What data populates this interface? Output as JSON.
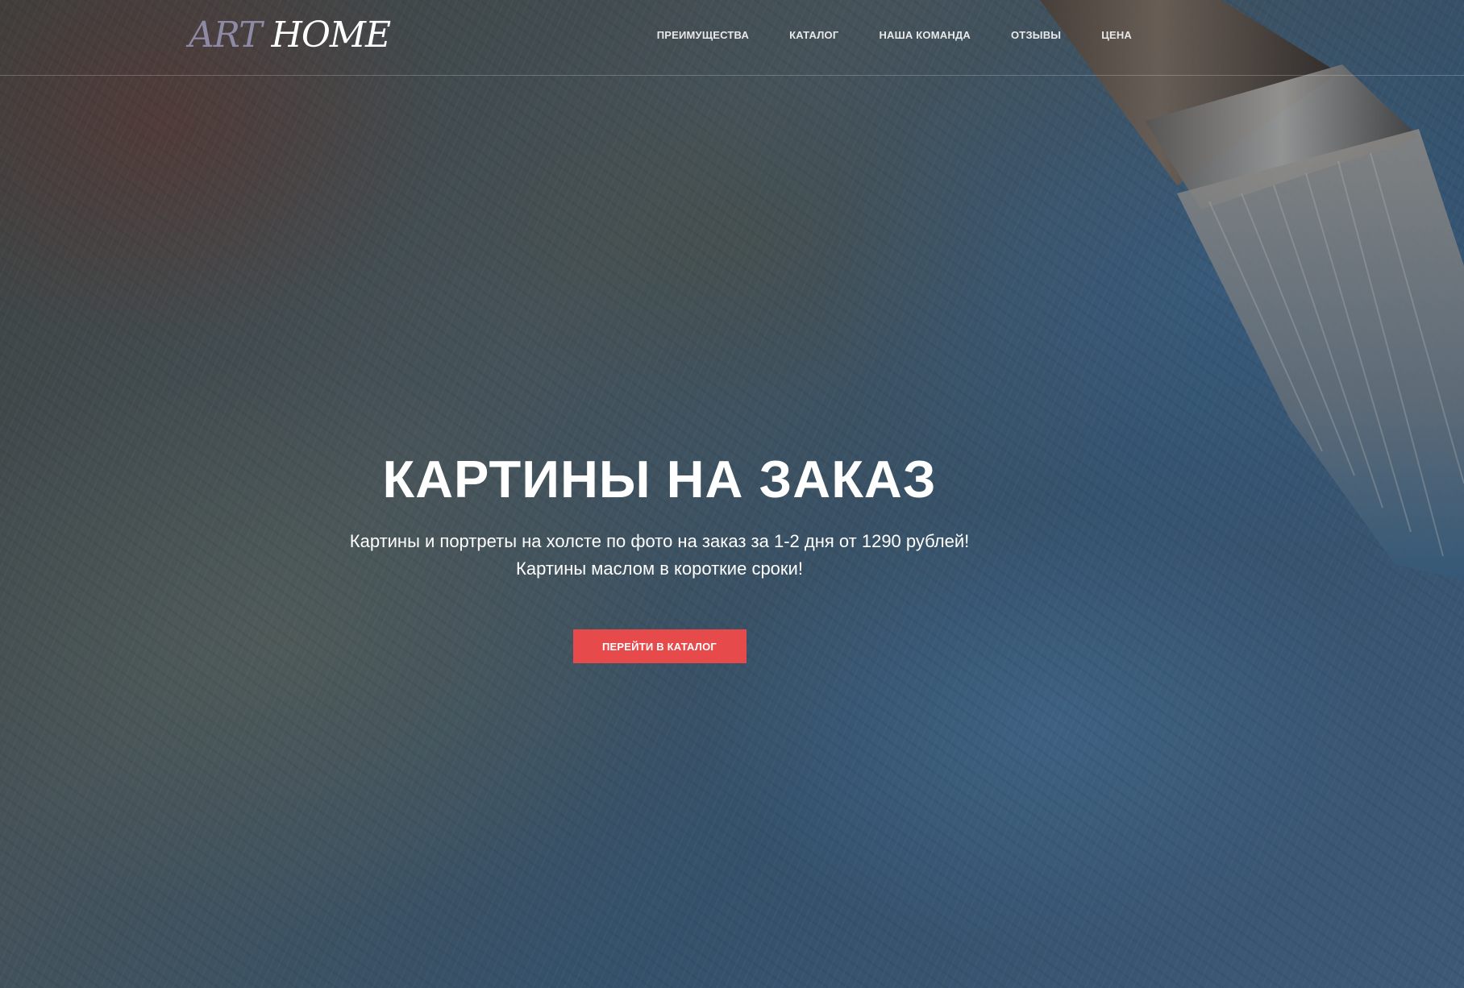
{
  "header": {
    "logo_part1": "ART",
    "logo_part2": "HOME",
    "nav": [
      {
        "label": "ПРЕИМУЩЕСТВА"
      },
      {
        "label": "КАТАЛОГ"
      },
      {
        "label": "НАША КОМАНДА"
      },
      {
        "label": "ОТЗЫВЫ"
      },
      {
        "label": "ЦЕНА"
      }
    ]
  },
  "hero": {
    "title": "КАРТИНЫ НА ЗАКАЗ",
    "subtitle_line1": "Картины и портреты на холсте по фото на заказ за 1-2 дня от 1290 рублей!",
    "subtitle_line2": "Картины маслом в короткие сроки!",
    "button_label": "ПЕРЕЙТИ В КАТАЛОГ"
  },
  "colors": {
    "accent": "#e74a4a",
    "logo_art": "#8e8aa6"
  },
  "icons": {
    "background": "oil-paint-brush-image"
  }
}
